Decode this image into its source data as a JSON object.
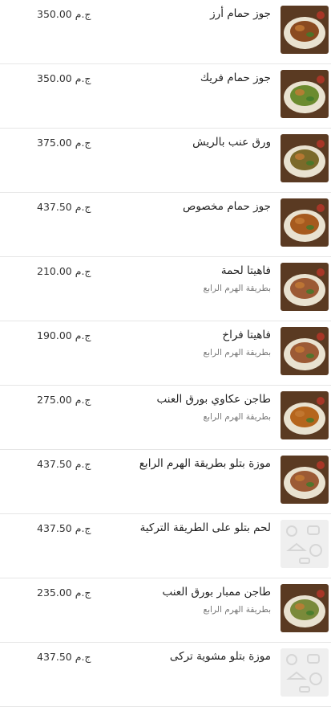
{
  "currency": "ج.م",
  "items": [
    {
      "name": "جوز حمام أرز",
      "price": "350.00",
      "subtitle": "",
      "image": "roasted-pigeon-rice-photo",
      "accent": "#8a4a20"
    },
    {
      "name": "جوز حمام فريك",
      "price": "350.00",
      "subtitle": "",
      "image": "pigeon-freekeh-photo",
      "accent": "#6b8b2f"
    },
    {
      "name": "ورق عنب بالريش",
      "price": "375.00",
      "subtitle": "",
      "image": "grape-leaves-ribs-photo",
      "accent": "#7b6a2a"
    },
    {
      "name": "جوز حمام مخصوص",
      "price": "437.50",
      "subtitle": "",
      "image": "special-pigeon-photo",
      "accent": "#a65a1e"
    },
    {
      "name": "فاهيتا لحمة",
      "price": "210.00",
      "subtitle": "بطريقة الهرم الرابع",
      "image": "meat-fajita-photo",
      "accent": "#9c5a35"
    },
    {
      "name": "فاهيتا فراخ",
      "price": "190.00",
      "subtitle": "بطريقة الهرم الرابع",
      "image": "chicken-fajita-photo",
      "accent": "#9c5a35"
    },
    {
      "name": "طاجن عكاوي بورق العنب",
      "price": "275.00",
      "subtitle": "بطريقة الهرم الرابع",
      "image": "oxtail-tagine-photo",
      "accent": "#b5651d"
    },
    {
      "name": "موزة بتلو بطريقة الهرم الرابع",
      "price": "437.50",
      "subtitle": "",
      "image": "veal-shank-photo",
      "accent": "#9c5a35"
    },
    {
      "name": "لحم بتلو على الطريقة التركية",
      "price": "437.50",
      "subtitle": "",
      "image": "placeholder-food-icons",
      "accent": "#d8d8d8"
    },
    {
      "name": "طاجن ممبار بورق العنب",
      "price": "235.00",
      "subtitle": "بطريقة الهرم الرابع",
      "image": "mombar-tagine-photo",
      "accent": "#7a8a3a"
    },
    {
      "name": "موزة بتلو مشوية تركى",
      "price": "437.50",
      "subtitle": "",
      "image": "placeholder-food-icons",
      "accent": "#d8d8d8"
    }
  ]
}
